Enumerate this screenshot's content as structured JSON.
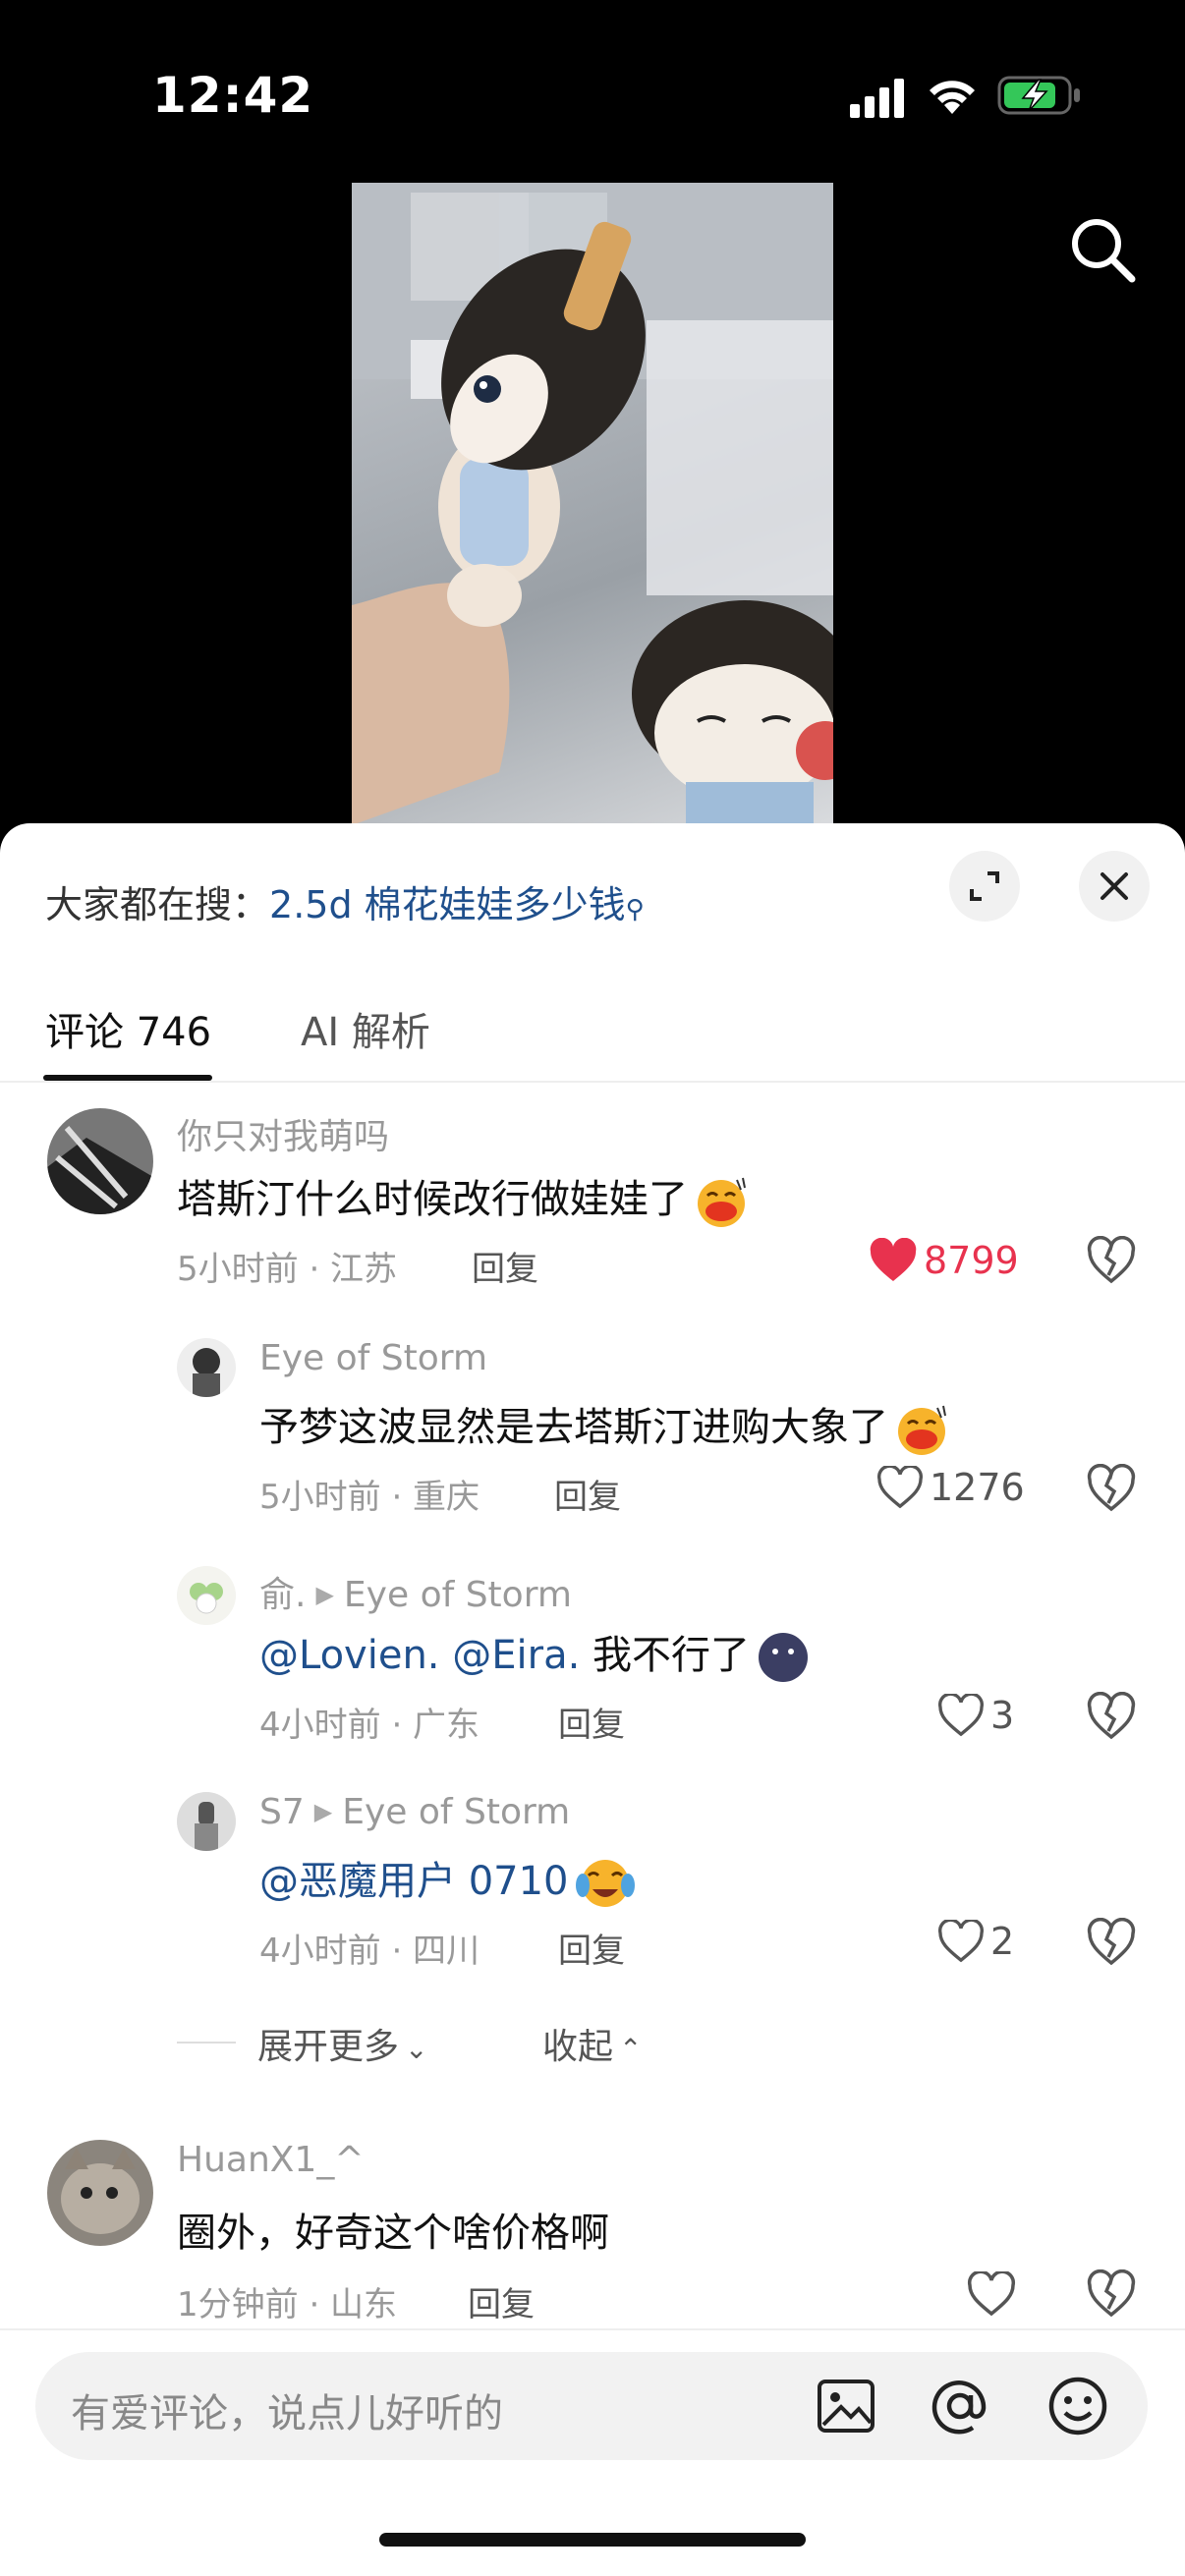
{
  "status_bar": {
    "time": "12:42"
  },
  "trending": {
    "label": "大家都在搜：",
    "query": "2.5d 棉花娃娃多少钱"
  },
  "tabs": [
    {
      "label": "评论 746"
    },
    {
      "label": "AI 解析"
    }
  ],
  "comments": [
    {
      "user": "你只对我萌吗",
      "text": "塔斯汀什么时候改行做娃娃了",
      "time": "5小时前 · 江苏",
      "reply": "回复",
      "likes": "8799",
      "liked": true
    },
    {
      "user": "Eye of Storm",
      "text": "予梦这波显然是去塔斯汀进购大象了",
      "time": "5小时前 · 重庆",
      "reply": "回复",
      "likes": "1276"
    },
    {
      "user": "俞.",
      "reply_to": "Eye of Storm",
      "mentions": [
        "@Lovien.",
        "@Eira."
      ],
      "text": "我不行了",
      "time": "4小时前 · 广东",
      "reply": "回复",
      "likes": "3"
    },
    {
      "user": "S7",
      "reply_to": "Eye of Storm",
      "mention": "@恶魔用户 0710",
      "time": "4小时前 · 四川",
      "reply": "回复",
      "likes": "2"
    },
    {
      "user": "HuanX1_^",
      "text": "圈外，好奇这个啥价格啊",
      "time": "1分钟前 · 山东",
      "reply": "回复"
    }
  ],
  "thread_controls": {
    "expand_more": "展开更多",
    "collapse": "收起"
  },
  "input": {
    "placeholder": "有爱评论，说点儿好听的"
  },
  "colors": {
    "like_red": "#e8324e",
    "link_blue": "#1f4f8c"
  }
}
